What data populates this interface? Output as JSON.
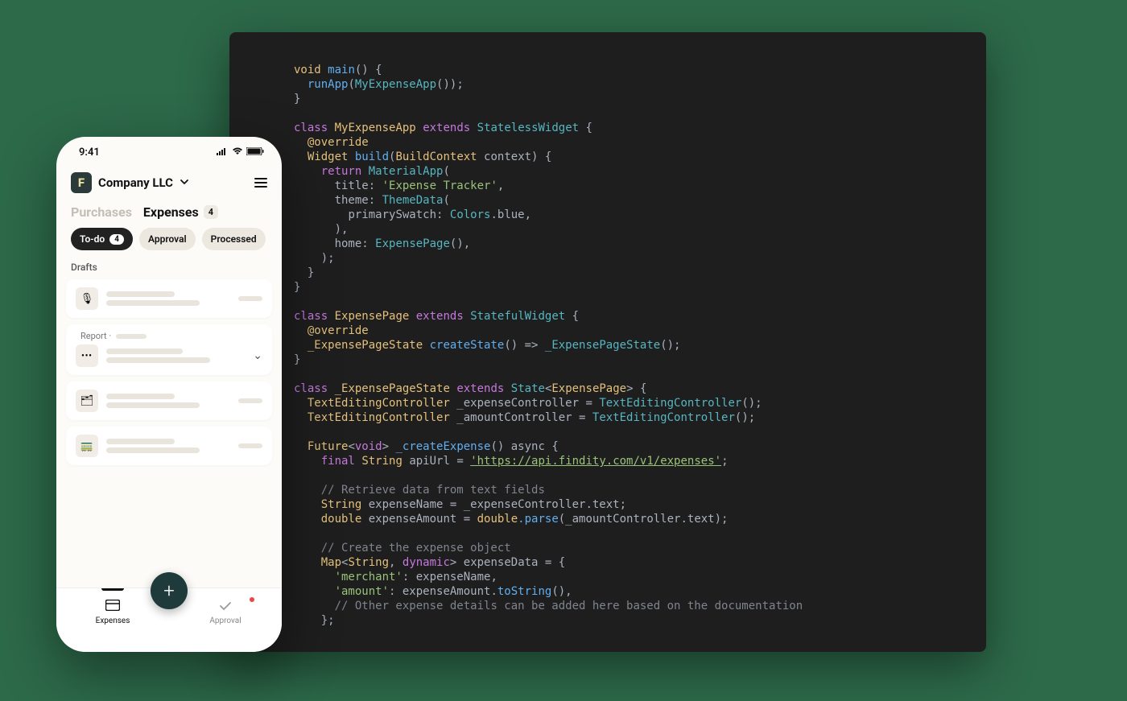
{
  "phone": {
    "status_time": "9:41",
    "company": "Company LLC",
    "menu_label": "Menu",
    "tabs": {
      "purchases": "Purchases",
      "expenses": "Expenses",
      "expenses_count": "4"
    },
    "subtabs": {
      "todo": "To-do",
      "todo_count": "4",
      "approval": "Approval",
      "processed": "Processed"
    },
    "section_drafts": "Drafts",
    "report_label": "Report ·",
    "nav": {
      "expenses": "Expenses",
      "approval": "Approval"
    }
  },
  "code": {
    "l1_void": "void",
    "l1_main": "main",
    "l1_rest": "() {",
    "l2_run": "runApp",
    "l2_app": "MyExpenseApp",
    "l2_rest": "());",
    "l3": "}",
    "l5_class": "class",
    "l5_name": "MyExpenseApp",
    "l5_ext": "extends",
    "l5_super": "StatelessWidget",
    "l5_open": " {",
    "l6_ann": "@override",
    "l7_widget": "Widget",
    "l7_build": "build",
    "l7_ctx_open": "(",
    "l7_ctxtype": "BuildContext",
    "l7_ctxvar": " context) {",
    "l8_return": "return",
    "l8_matapp": "MaterialApp",
    "l8_open": "(",
    "l9_title_k": "title:",
    "l9_title_v": "'Expense Tracker'",
    "l9_comma": ",",
    "l10_theme_k": "theme:",
    "l10_theme_v": "ThemeData",
    "l10_open": "(",
    "l11_swatch_k": "primarySwatch:",
    "l11_colors": "Colors",
    "l11_blue": ".blue,",
    "l12_close": "),",
    "l13_home_k": "home:",
    "l13_home_v": "ExpensePage",
    "l13_call": "(),",
    "l14_close": ");",
    "l15_close": "}",
    "l16_close": "}",
    "l18_class": "class",
    "l18_name": "ExpensePage",
    "l18_ext": "extends",
    "l18_super": "StatefulWidget",
    "l18_open": " {",
    "l19_ann": "@override",
    "l20_state": "_ExpensePageState",
    "l20_create": "createState",
    "l20_arrow": "() => ",
    "l20_state2": "_ExpensePageState",
    "l20_call": "();",
    "l21_close": "}",
    "l23_class": "class",
    "l23_name": "_ExpensePageState",
    "l23_ext": "extends",
    "l23_state": "State",
    "l23_gen_open": "<",
    "l23_page": "ExpensePage",
    "l23_gen_close": "> {",
    "l24_tec": "TextEditingController",
    "l24_var": " _expenseController = ",
    "l24_tec2": "TextEditingController",
    "l24_call": "();",
    "l25_tec": "TextEditingController",
    "l25_var": " _amountController = ",
    "l25_tec2": "TextEditingController",
    "l25_call": "();",
    "l27_future": "Future",
    "l27_void_open": "<",
    "l27_void": "void",
    "l27_void_close": ">",
    "l27_fn": " _createExpense",
    "l27_async": "() async {",
    "l28_final": "final",
    "l28_string": "String",
    "l28_eq": " apiUrl = ",
    "l28_url": "'https://api.findity.com/v1/expenses'",
    "l28_semi": ";",
    "l30_com": "// Retrieve data from text fields",
    "l31_string": "String",
    "l31_rest": " expenseName = _expenseController.text;",
    "l32_double": "double",
    "l32_mid": " expenseAmount = ",
    "l32_dbl": "double",
    "l32_parse": ".parse",
    "l32_rest": "(_amountController.text);",
    "l34_com": "// Create the expense object",
    "l35_map": "Map",
    "l35_open": "<",
    "l35_str": "String",
    "l35_comma": ", ",
    "l35_dyn": "dynamic",
    "l35_close": ">",
    "l35_rest": " expenseData = {",
    "l36_k": "'merchant'",
    "l36_v": ": expenseName,",
    "l37_k": "'amount'",
    "l37_v": ": expenseAmount.",
    "l37_tostr": "toString",
    "l37_call": "(),",
    "l38_com": "// Other expense details can be added here based on the documentation",
    "l39": "};"
  }
}
